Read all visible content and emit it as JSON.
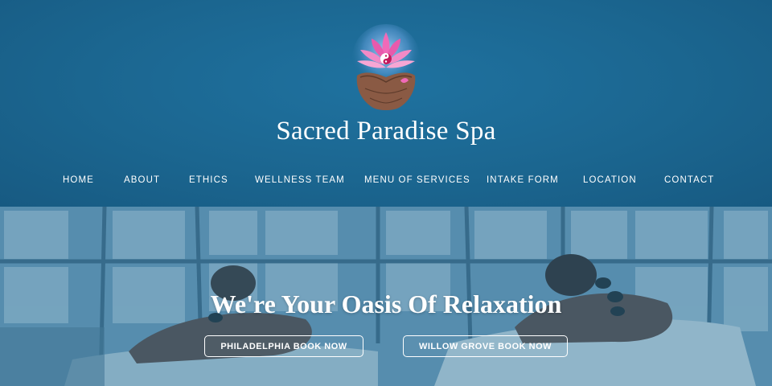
{
  "site": {
    "title": "Sacred Paradise Spa",
    "logo_icon": "lotus-yin-yang-hands-icon"
  },
  "nav": {
    "items": [
      {
        "label": "HOME"
      },
      {
        "label": "ABOUT"
      },
      {
        "label": "ETHICS"
      },
      {
        "label": "WELLNESS TEAM"
      },
      {
        "label": "MENU OF SERVICES"
      },
      {
        "label": "INTAKE FORM"
      },
      {
        "label": "LOCATION"
      },
      {
        "label": "CONTACT"
      }
    ]
  },
  "hero": {
    "headline": "We're Your Oasis Of Relaxation",
    "buttons": [
      {
        "label": "PHILADELPHIA BOOK NOW"
      },
      {
        "label": "WILLOW GROVE BOOK NOW"
      }
    ]
  },
  "colors": {
    "header_bg": "#1b6690",
    "text": "#ffffff",
    "hero_tint": "#16608c"
  }
}
